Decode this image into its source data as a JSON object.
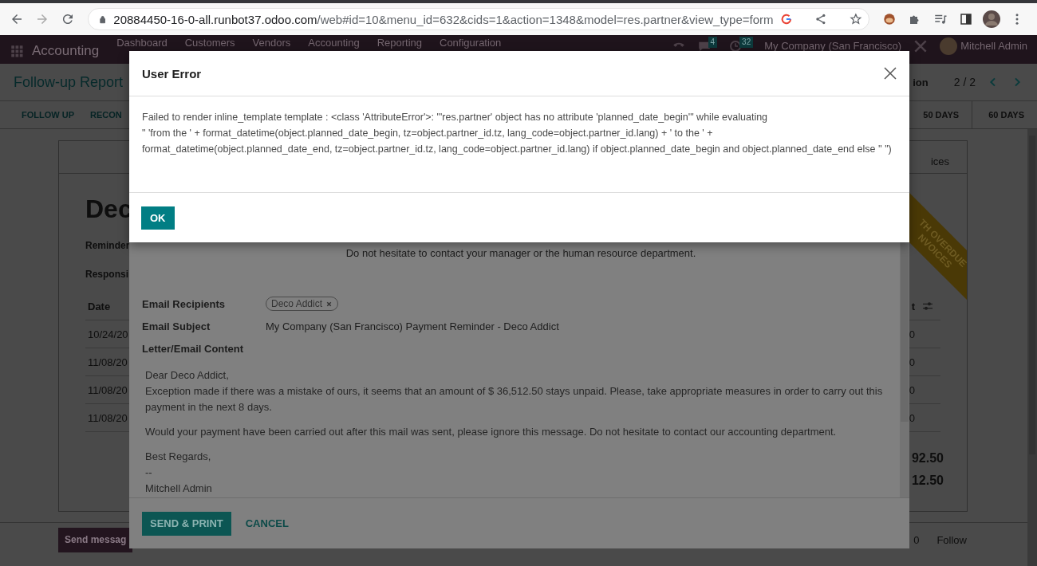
{
  "browser": {
    "url_host": "20884450-16-0-all.runbot37.odoo.com",
    "url_path": "/web#id=10&menu_id=632&cids=1&action=1348&model=res.partner&view_type=form"
  },
  "navbar": {
    "app": "Accounting",
    "menu": [
      "Dashboard",
      "Customers",
      "Vendors",
      "Accounting",
      "Reporting",
      "Configuration"
    ],
    "chat_count": "4",
    "activity_count": "32",
    "company": "My Company (San Francisco)",
    "user": "Mitchell Admin"
  },
  "control_panel": {
    "title": "Follow-up Report",
    "action": "ion",
    "pager": "2 / 2"
  },
  "status_bar": {
    "buttons": [
      "FOLLOW UP",
      "RECON"
    ],
    "stages": [
      "50 DAYS",
      "60 DAYS"
    ]
  },
  "sheet": {
    "tab": "ices",
    "heading": "Dec",
    "labels": [
      "Reminder",
      "Responsi"
    ],
    "table": {
      "column_1": "Date",
      "column_2": "t",
      "rows": [
        {
          "date": "10/24/20",
          "amount": "0"
        },
        {
          "date": "11/08/20",
          "amount": "0"
        },
        {
          "date": "11/08/20",
          "amount": "0"
        },
        {
          "date": "11/08/20",
          "amount": "0"
        }
      ]
    },
    "totals": [
      "92.50",
      "12.50"
    ],
    "ribbon": [
      "TH OVERDUE",
      "NVOICES"
    ]
  },
  "chatter": {
    "send_button": "Send messag",
    "count": "0",
    "follow": "Follow"
  },
  "send_dialog": {
    "notice": "Do not hesitate to contact your manager or the human resource department.",
    "recipients_label": "Email Recipients",
    "recipients": [
      "Deco Addict"
    ],
    "subject_label": "Email Subject",
    "subject": "My Company (San Francisco) Payment Reminder - Deco Addict",
    "content_label": "Letter/Email Content",
    "content": [
      [
        "Dear Deco Addict,",
        "Exception made if there was a mistake of ours, it seems that an amount of $ 36,512.50 stays unpaid. Please, take appropriate measures in order to carry out this payment in the next 8 days."
      ],
      [
        "Would your payment have been carried out after this mail was sent, please ignore this message. Do not hesitate to contact our accounting department."
      ],
      [
        "Best Regards,",
        "--",
        "Mitchell Admin"
      ]
    ],
    "buttons": [
      "SEND & PRINT",
      "CANCEL"
    ]
  },
  "error_dialog": {
    "title": "User Error",
    "message": "Failed to render inline_template template : <class 'AttributeError'>: \"'res.partner' object has no attribute 'planned_date_begin'\" while evaluating\n\" 'from the ' + format_datetime(object.planned_date_begin, tz=object.partner_id.tz, lang_code=object.partner_id.lang) + ' to the ' + format_datetime(object.planned_date_end, tz=object.partner_id.tz, lang_code=object.partner_id.lang) if object.planned_date_begin and object.planned_date_end else '' \")",
    "button": "OK"
  }
}
